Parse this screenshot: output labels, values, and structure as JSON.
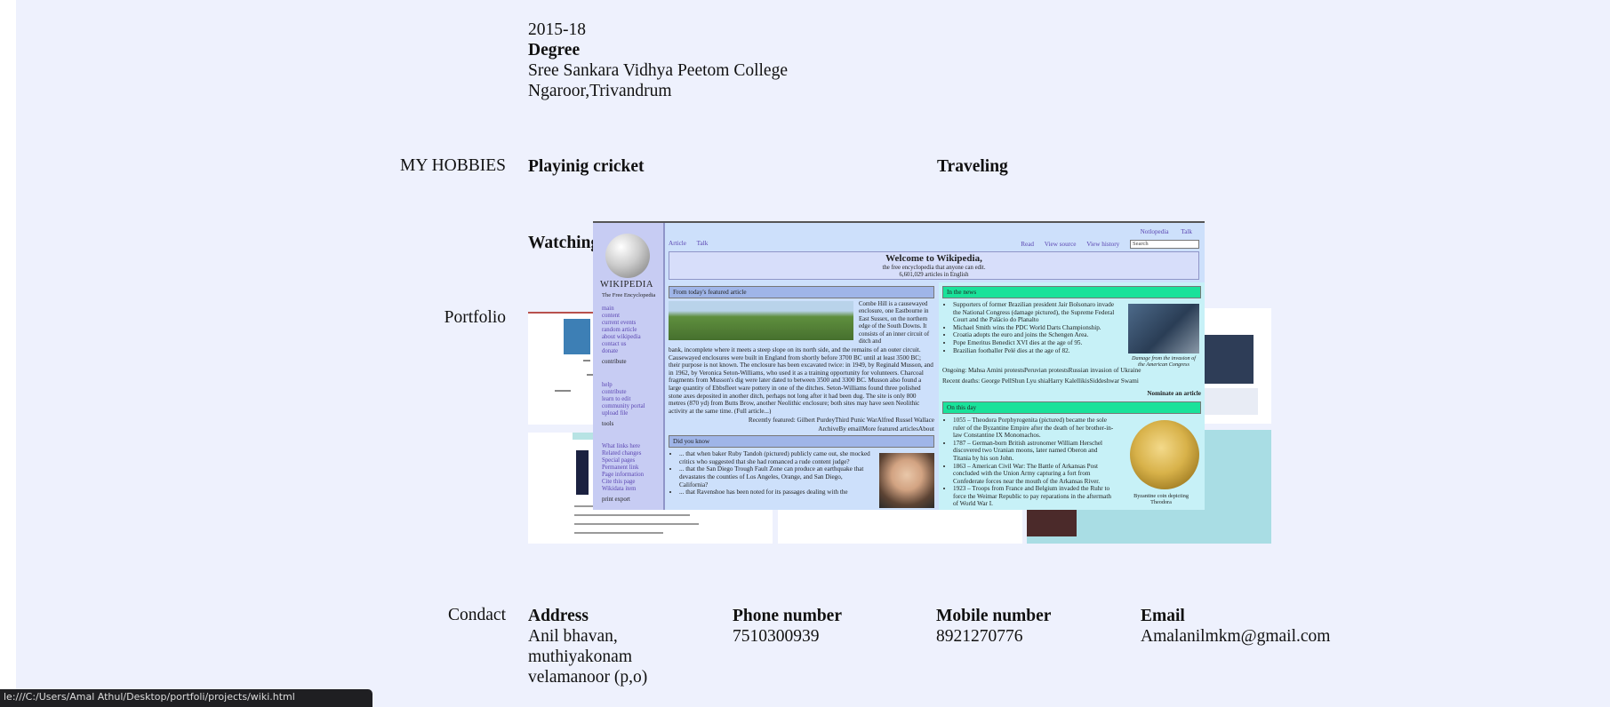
{
  "education": {
    "year": "2015-18",
    "degree": "Degree",
    "college": "Sree Sankara Vidhya Peetom College",
    "location": "Ngaroor,Trivandrum"
  },
  "hobbies": {
    "label": "MY HOBBIES",
    "items": [
      "Playinig cricket",
      "Traveling",
      "Watching"
    ]
  },
  "portfolio": {
    "label": "Portfolio"
  },
  "wiki_preview": {
    "top_links": [
      "Notlopedia",
      "Talk"
    ],
    "tabs_left": [
      "Article",
      "Talk"
    ],
    "tabs_right": [
      "Read",
      "View source",
      "View history"
    ],
    "search_placeholder": "Search",
    "brand": "WIKIPEDIA",
    "brand_sub": "The Free Encyclopedia",
    "nav_main": [
      "main",
      "content",
      "current events",
      "random article",
      "about wikipedia",
      "contact us",
      "donate"
    ],
    "nav_contribute_head": "contribute",
    "nav_contribute": [
      "help",
      "contribute",
      "learn to edit",
      "community portal",
      "upload file"
    ],
    "nav_tools_head": "tools",
    "nav_tools": [
      "What links here",
      "Related changes",
      "Special pages",
      "Permanent link",
      "Page information",
      "Cite this page",
      "Wikidata item"
    ],
    "nav_print_head": "print export",
    "welcome_title": "Welcome to Wikipedia,",
    "welcome_sub1": "the free encyclopedia that anyone can edit.",
    "welcome_sub2": "6,601,029 articles in English",
    "featured_head": "From today's featured article",
    "featured_side": "Combe Hill is a causewayed enclosure, one Eastbourne in East Sussex, on the northern edge of the South Downs. It consists of an inner circuit of ditch and",
    "featured_body": "bank, incomplete where it meets a steep slope on its north side, and the remains of an outer circuit. Causewayed enclosures were built in England from shortly before 3700 BC until at least 3500 BC; their purpose is not known. The enclosure has been excavated twice: in 1949, by Reginald Musson, and in 1962, by Veronica Seton-Williams, who used it as a training opportunity for volunteers. Charcoal fragments from Musson's dig were later dated to between 3500 and 3300 BC. Musson also found a large quantity of Ebbsfleet ware pottery in one of the ditches. Seton-Williams found three polished stone axes deposited in another ditch, perhaps not long after it had been dug. The site is only 800 metres (870 yd) from Butts Brow, another Neolithic enclosure; both sites may have seen Neolithic activity at the same time. (Full article...)",
    "featured_recent": "Recently featured: Gilbert PurdeyThird Punic WarAlfred Russel Wallace",
    "featured_archive": "ArchiveBy emailMore featured articlesAbout",
    "dyk_head": "Did you know",
    "dyk_items": [
      "... that when baker Ruby Tandoh (pictured) publicly came out, she mocked critics who suggested that she had romanced a rude content judge?",
      "... that the San Diego Trough Fault Zone can produce an earthquake that devastates the counties of Los Angeles, Orange, and San Diego, California?",
      "... that Ravenshoe has been noted for its passages dealing with the"
    ],
    "news_head": "In the news",
    "news_items": [
      "Supporters of former Brazilian president Jair Bolsonaro invade the National Congress (damage pictured), the Supreme Federal Court and the Palácio do Planalto",
      "Michael Smith wins the PDC World Darts Championship.",
      "Croatia adopts the euro and joins the Schengen Area.",
      "Pope Emeritus Benedict XVI dies at the age of 95.",
      "Brazilian footballer Pelé dies at the age of 82."
    ],
    "news_caption": "Damage from the invasion of the American Congress",
    "news_ongoing": "Ongoing: Mahsa Amini protestsPeruvian protestsRussian invasion of Ukraine",
    "news_deaths": "Recent deaths: George PellShun Lyu shiaHarry KalellikisSiddeshwar Swami",
    "nominate": "Nominate an article",
    "otd_head": "On this day",
    "otd_items": [
      "1055 – Theodora Porphyrogenita (pictured) became the sole ruler of the Byzantine Empire after the death of her brother-in-law Constantine IX Monomachos.",
      "1787 – German-born British astronomer William Herschel discovered two Uranian moons, later named Oberon and Titania by his son John.",
      "1863 – American Civil War: The Battle of Arkansas Post concluded with the Union Army capturing a fort from Confederate forces near the mouth of the Arkansas River.",
      "1923 – Troops from France and Belgium invaded the Ruhr to force the Weimar Republic to pay reparations in the aftermath of World War I."
    ],
    "otd_caption": "Byzantine coin depicting Theodora"
  },
  "contact": {
    "label": "Condact",
    "address_head": "Address",
    "address_lines": [
      "Anil bhavan,",
      "muthiyakonam",
      "velamanoor (p,o)"
    ],
    "phone_head": "Phone number",
    "phone": "7510300939",
    "mobile_head": "Mobile number",
    "mobile": "8921270776",
    "email_head": "Email",
    "email": "Amalanilmkm@gmail.com"
  },
  "status_url": "le:///C:/Users/Amal Athul/Desktop/portfoli/projects/wiki.html"
}
